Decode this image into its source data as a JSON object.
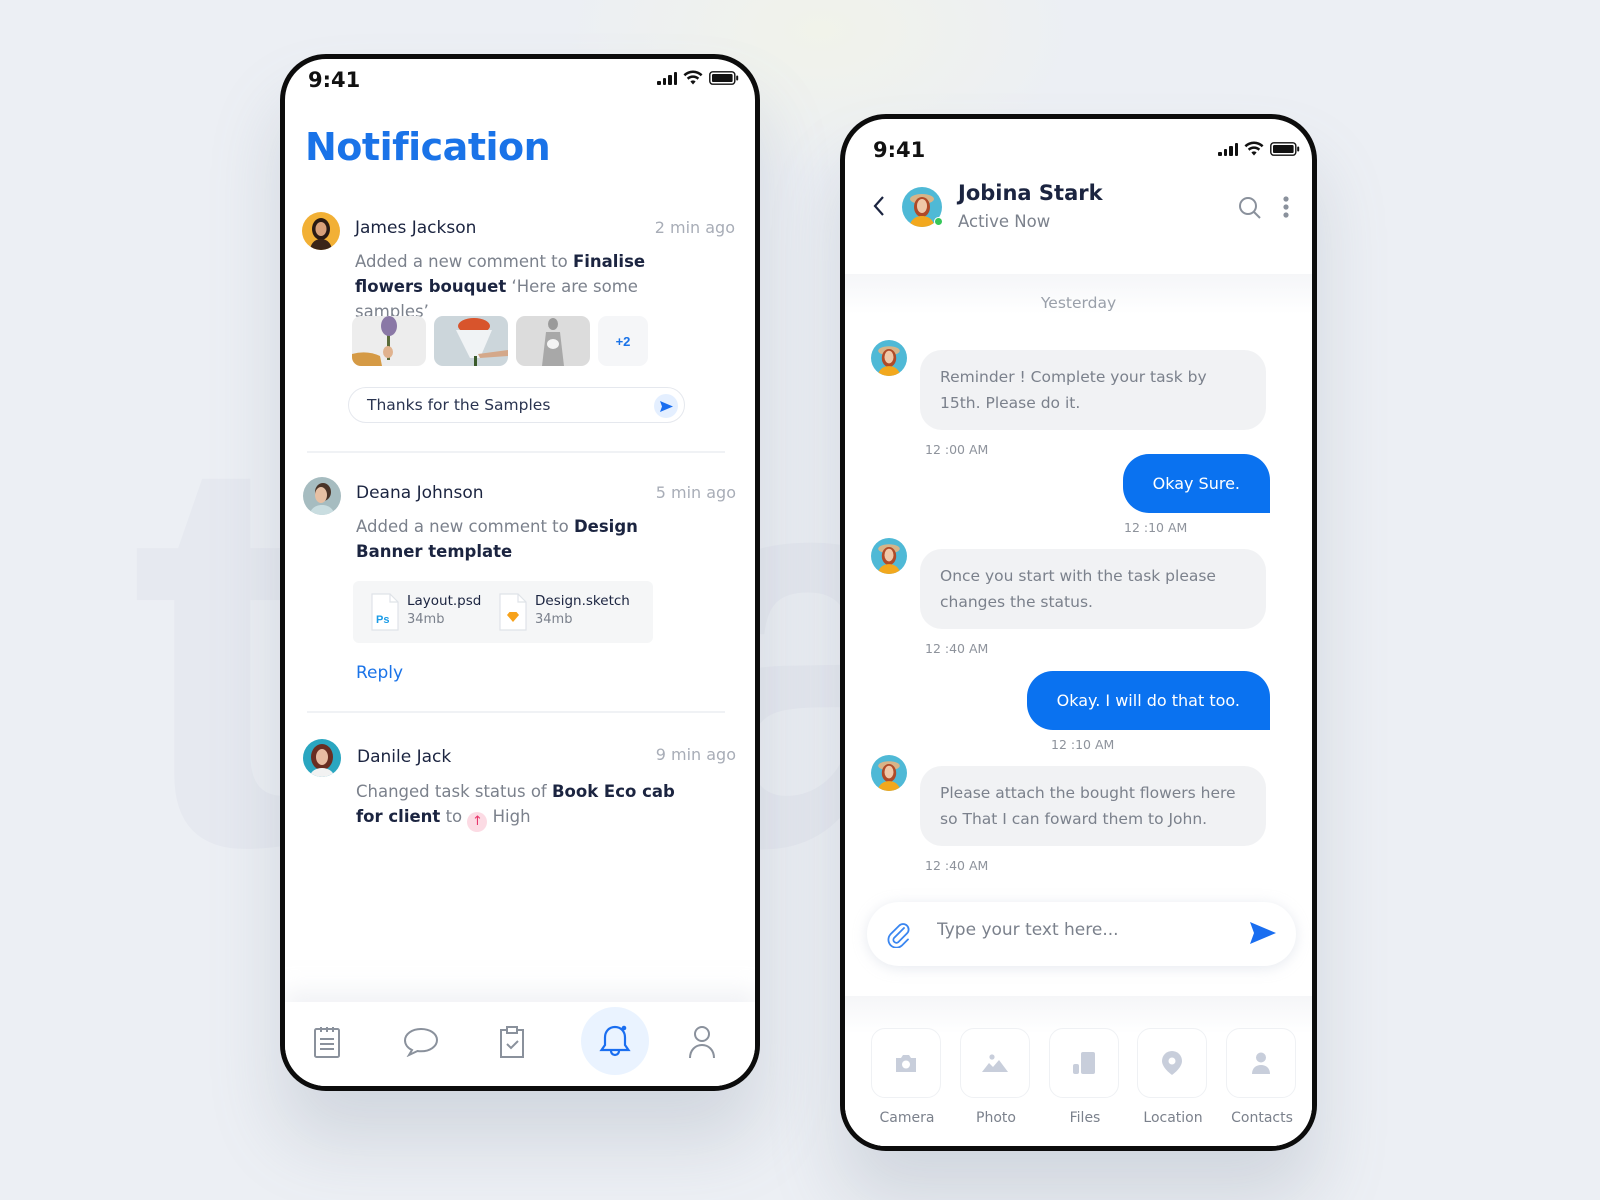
{
  "background": {
    "watermark": "tra"
  },
  "colors": {
    "accent": "#1a73e8",
    "bubble_out": "#0a72f0",
    "bubble_in": "#f1f2f4",
    "online": "#35c759",
    "priority": "#e8356a"
  },
  "notification_screen": {
    "status_bar": {
      "time": "9:41"
    },
    "title": "Notification",
    "items": [
      {
        "name": "James Jackson",
        "time": "2 min ago",
        "prefix": "Added a new comment to ",
        "target": "Finalise flowers bouquet",
        "suffix": "  ‘Here are some samples’",
        "thumbnails": [
          "lavender-bouquet-photo",
          "red-roses-bouquet-photo",
          "bride-bouquet-photo"
        ],
        "more_count": "+2",
        "reply_value": "Thanks for the Samples"
      },
      {
        "name": "Deana Johnson",
        "time": "5 min ago",
        "prefix": "Added a new comment to ",
        "target": "Design Banner template",
        "files": [
          {
            "name": "Layout.psd",
            "size": "34mb",
            "icon": "photoshop-file-icon"
          },
          {
            "name": "Design.sketch",
            "size": "34mb",
            "icon": "sketch-file-icon"
          }
        ],
        "reply_label": "Reply"
      },
      {
        "name": "Danile Jack",
        "time": "9 min ago",
        "prefix": "Changed task status of ",
        "target": "Book Eco cab for client",
        "mid": " to ",
        "priority": "High"
      }
    ],
    "tabbar": [
      {
        "icon": "notepad-icon",
        "active": false
      },
      {
        "icon": "chat-bubble-icon",
        "active": false
      },
      {
        "icon": "clipboard-check-icon",
        "active": false
      },
      {
        "icon": "bell-icon",
        "active": true
      },
      {
        "icon": "user-icon",
        "active": false
      }
    ]
  },
  "chat_screen": {
    "status_bar": {
      "time": "9:41"
    },
    "contact": {
      "name": "Jobina Stark",
      "status": "Active Now"
    },
    "day_label": "Yesterday",
    "messages": [
      {
        "direction": "in",
        "text": "Reminder ! Complete your task by 15th. Please do it.",
        "time": "12 :00 AM"
      },
      {
        "direction": "out",
        "text": "Okay Sure.",
        "time": "12 :10 AM"
      },
      {
        "direction": "in",
        "text": "Once you start with the  task please changes the status.",
        "time": "12 :40 AM"
      },
      {
        "direction": "out",
        "text": "Okay. I will do that too.",
        "time": "12 :10 AM"
      },
      {
        "direction": "in",
        "text": "Please attach the bought flowers here so That I can foward them to John.",
        "time": "12 :40 AM"
      }
    ],
    "composer": {
      "placeholder": "Type your text here...",
      "value": ""
    },
    "attach_options": [
      {
        "label": "Camera",
        "icon": "camera-icon"
      },
      {
        "label": "Photo",
        "icon": "image-icon"
      },
      {
        "label": "Files",
        "icon": "files-icon"
      },
      {
        "label": "Location",
        "icon": "location-pin-icon"
      },
      {
        "label": "Contacts",
        "icon": "contact-icon"
      }
    ]
  }
}
